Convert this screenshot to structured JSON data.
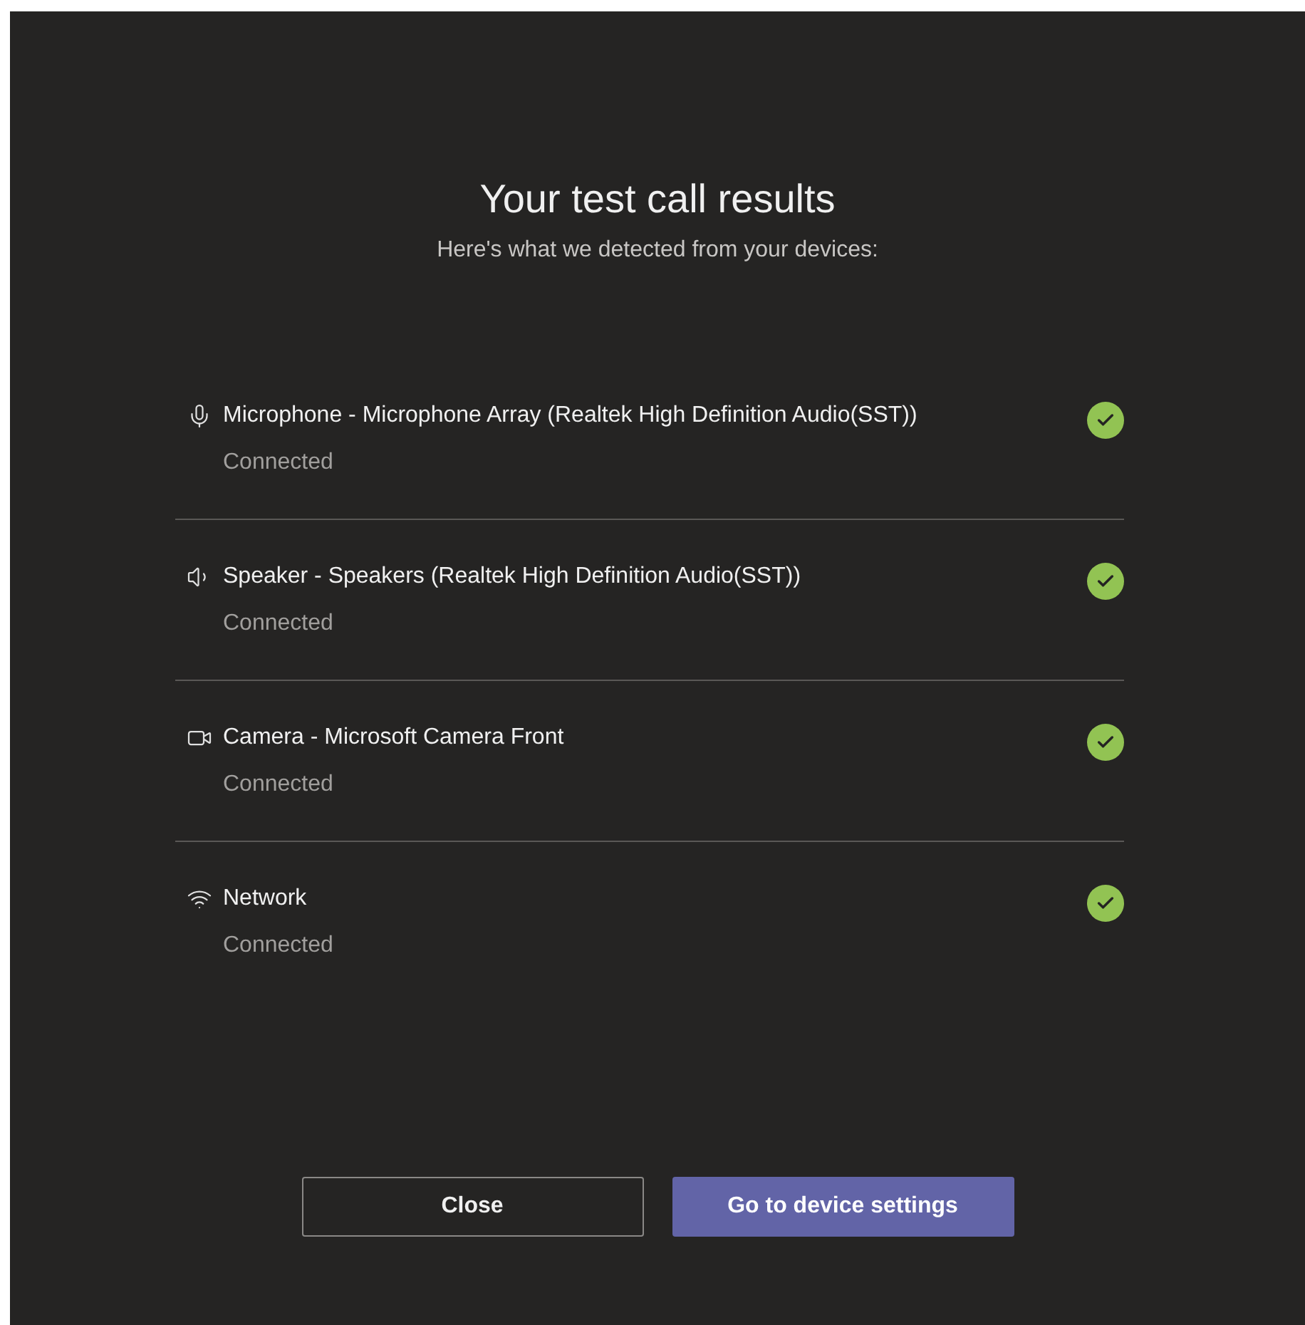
{
  "title": "Your test call results",
  "subtitle": "Here's what we detected from your devices:",
  "devices": [
    {
      "kind": "microphone",
      "name": "Microphone - Microphone Array (Realtek High Definition Audio(SST))",
      "status": "Connected",
      "ok": true
    },
    {
      "kind": "speaker",
      "name": "Speaker - Speakers (Realtek High Definition Audio(SST))",
      "status": "Connected",
      "ok": true
    },
    {
      "kind": "camera",
      "name": "Camera - Microsoft Camera Front",
      "status": "Connected",
      "ok": true
    },
    {
      "kind": "network",
      "name": "Network",
      "status": "Connected",
      "ok": true
    }
  ],
  "buttons": [
    {
      "kind": "secondary",
      "label": "Close"
    },
    {
      "kind": "primary",
      "label": "Go to device settings"
    }
  ]
}
